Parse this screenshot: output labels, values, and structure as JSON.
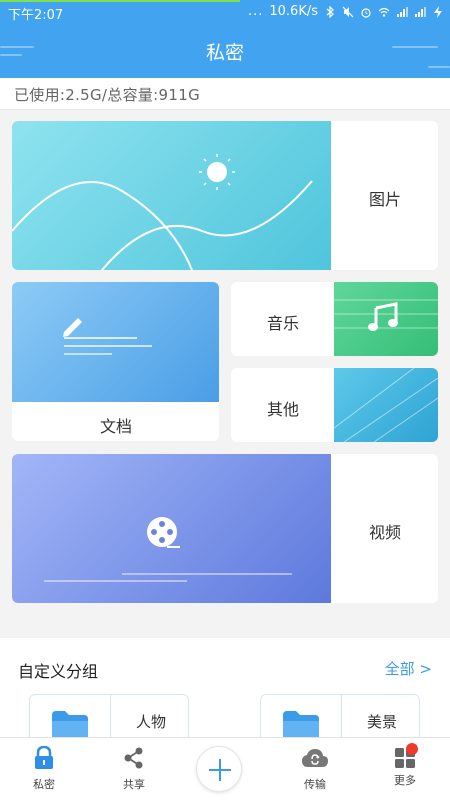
{
  "status_bar": {
    "time": "下午2:07",
    "more_dots": "...",
    "network_speed": "10.6K/s"
  },
  "header": {
    "title": "私密"
  },
  "storage": {
    "text": "已使用:2.5G/总容量:911G"
  },
  "categories": {
    "pictures": "图片",
    "documents": "文档",
    "music": "音乐",
    "others": "其他",
    "videos": "视频"
  },
  "custom_groups": {
    "title": "自定义分组",
    "all_link": "全部 >",
    "items": [
      {
        "label": "人物"
      },
      {
        "label": "美景"
      }
    ]
  },
  "bottom_nav": {
    "private": "私密",
    "share": "共享",
    "transfer": "传输",
    "more": "更多"
  },
  "colors": {
    "header_blue": "#42a4f0",
    "accent_blue": "#3b9bea",
    "badge_red": "#f03a2b"
  }
}
